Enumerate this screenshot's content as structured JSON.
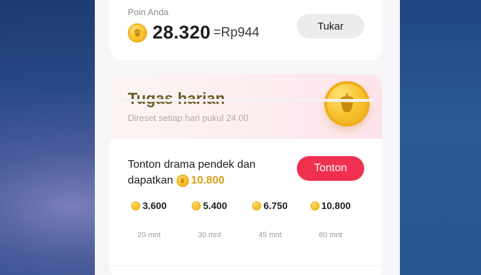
{
  "points": {
    "label": "Poin Anda",
    "value": "28.320",
    "equals": "=",
    "rupiah": "Rp944",
    "exchange_button": "Tukar"
  },
  "daily_tasks": {
    "title": "Tugas harian",
    "subtitle": "Direset setiap hari pukul 24.00",
    "task": {
      "text_line1": "Tonton drama pendek dan",
      "text_line2": "dapatkan",
      "reward": "10.800",
      "button": "Tonton"
    },
    "milestones": [
      {
        "reward": "3.600",
        "time": "20 mnt"
      },
      {
        "reward": "5.400",
        "time": "30 mnt"
      },
      {
        "reward": "6.750",
        "time": "45 mnt"
      },
      {
        "reward": "10.800",
        "time": "60 mnt"
      }
    ]
  },
  "icons": {
    "coin": "coin-icon"
  },
  "colors": {
    "accent": "#f0304f",
    "coin_gold": "#f8c431",
    "reward_text": "#d4a21a",
    "title_text": "#6b5a24"
  }
}
